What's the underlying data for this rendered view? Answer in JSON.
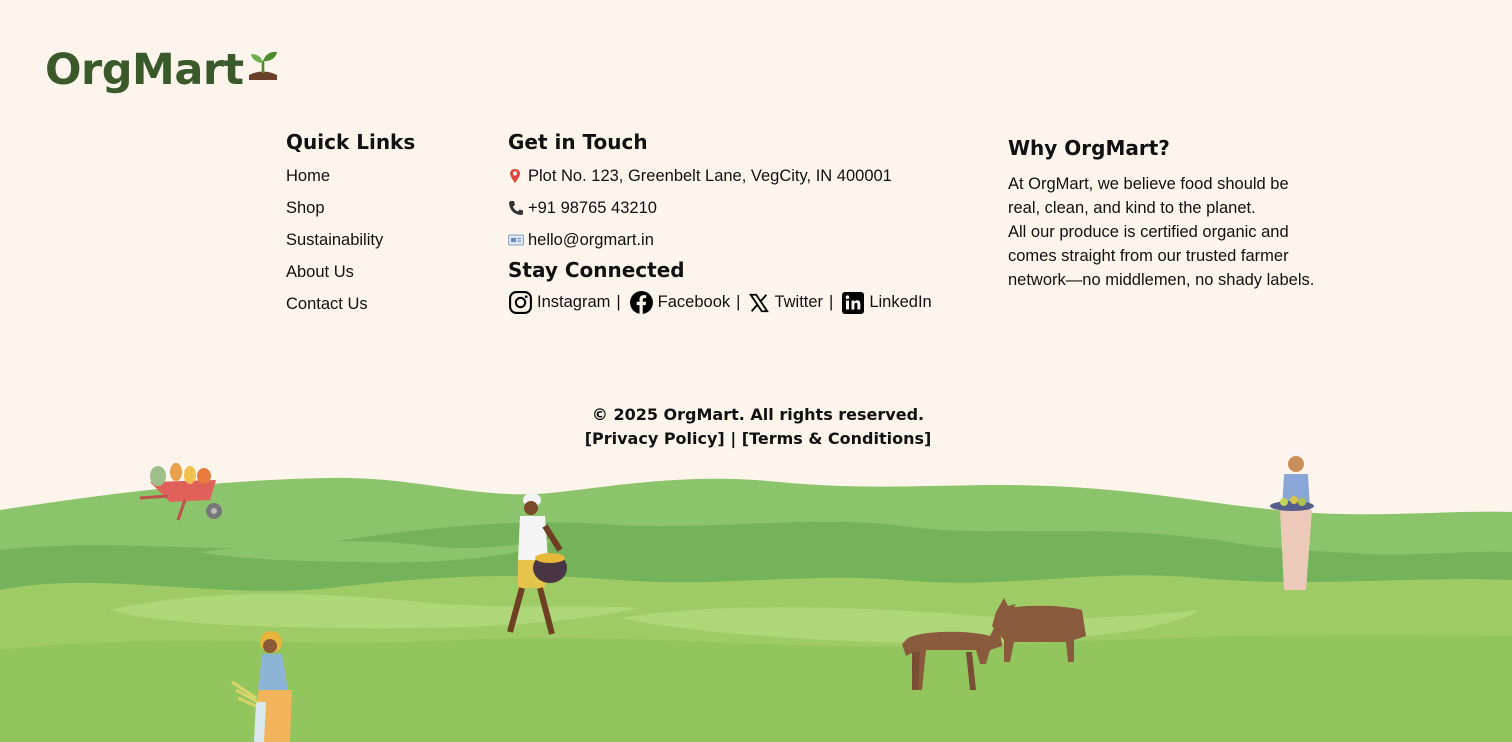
{
  "brand": {
    "name": "OrgMart",
    "icon": "seedling-icon"
  },
  "quick_links": {
    "title": "Quick Links",
    "items": [
      "Home",
      "Shop",
      "Sustainability",
      "About Us",
      "Contact Us"
    ]
  },
  "contact": {
    "title": "Get in Touch",
    "address": "Plot No. 123, Greenbelt Lane, VegCity, IN 400001",
    "phone": "+91 98765 43210",
    "email": "hello@orgmart.in",
    "icons": [
      "pin-icon",
      "phone-icon",
      "mail-icon"
    ]
  },
  "social": {
    "title": "Stay Connected",
    "items": [
      {
        "label": "Instagram",
        "icon": "instagram-icon"
      },
      {
        "label": "Facebook",
        "icon": "facebook-icon"
      },
      {
        "label": "Twitter",
        "icon": "x-twitter-icon"
      },
      {
        "label": "LinkedIn",
        "icon": "linkedin-icon"
      }
    ],
    "separator": "|"
  },
  "why": {
    "title": "Why OrgMart?",
    "line1": "At OrgMart, we believe food should be real, clean, and kind to the planet.",
    "line2": "All our produce is certified organic and comes straight from our trusted farmer network—no middlemen, no shady labels."
  },
  "footer": {
    "copyright": "© 2025 OrgMart. All rights reserved.",
    "privacy": "[Privacy Policy]",
    "separator": "|",
    "terms": "[Terms & Conditions]"
  },
  "colors": {
    "background": "#fdf4ec",
    "brand_green": "#3a5a2c",
    "field_light": "#8fc46a",
    "field_dark": "#6aad52",
    "cow": "#8a5a3c"
  }
}
